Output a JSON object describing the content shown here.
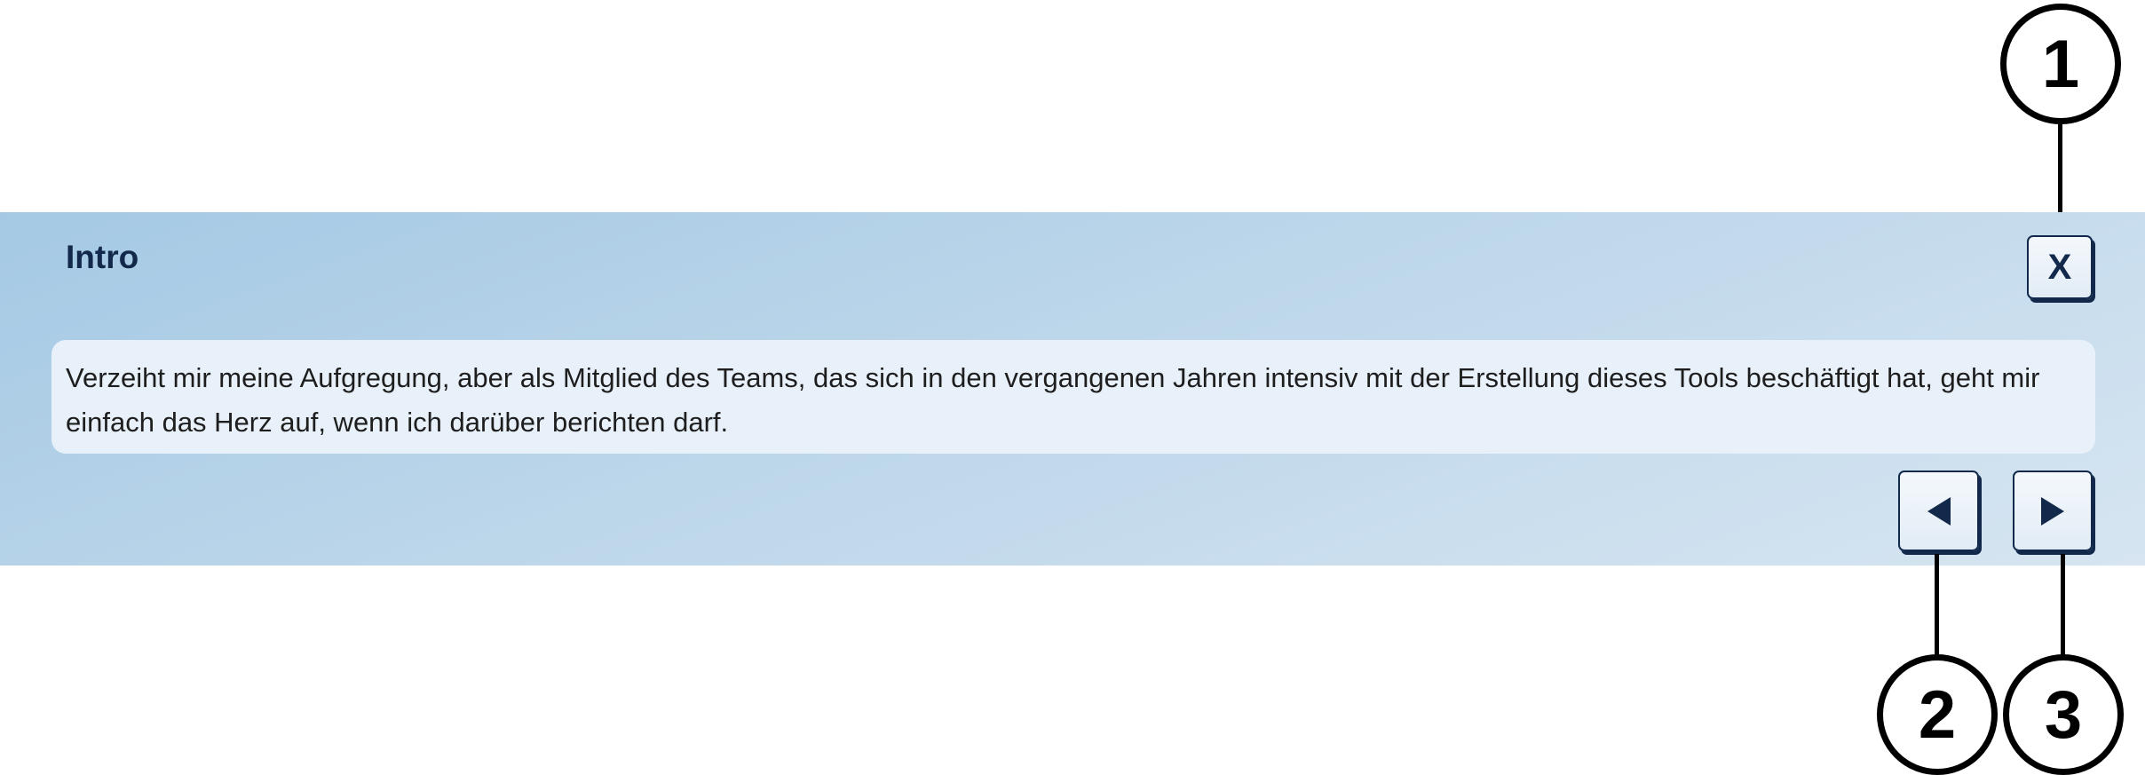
{
  "dialog": {
    "title": "Intro",
    "close_label": "X",
    "text": "Verzeiht mir meine Aufgregung, aber als Mitglied des Teams, das sich in den vergangenen Jahren intensiv mit der Erstellung dieses Tools beschäftigt hat, geht mir einfach das Herz auf, wenn ich darüber berichten darf.",
    "prev_icon": "triangle-left-icon",
    "next_icon": "triangle-right-icon"
  },
  "callouts": [
    {
      "label": "1",
      "target": "close-button"
    },
    {
      "label": "2",
      "target": "previous-button"
    },
    {
      "label": "3",
      "target": "next-button"
    }
  ],
  "colors": {
    "panel_gradient_start": "#a5c9e4",
    "panel_gradient_end": "#d6e5f1",
    "text_box": "#e8f0f9",
    "button_border": "#13294b",
    "title": "#13294b"
  }
}
